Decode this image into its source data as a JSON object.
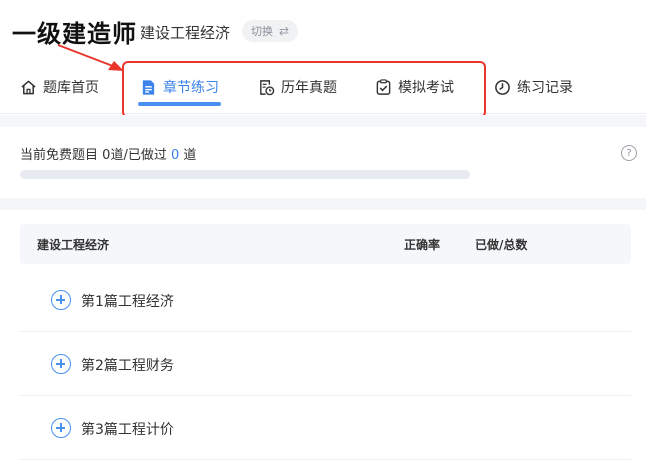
{
  "header": {
    "brand": "一级建造师",
    "subject": "建设工程经济",
    "switch_label": "切换",
    "switch_glyph": "⇄"
  },
  "nav": [
    {
      "label": "题库首页",
      "icon": "home-icon",
      "active": false
    },
    {
      "label": "章节练习",
      "icon": "document-icon",
      "active": true
    },
    {
      "label": "历年真题",
      "icon": "exam-history-icon",
      "active": false
    },
    {
      "label": "模拟考试",
      "icon": "mock-exam-icon",
      "active": false
    },
    {
      "label": "练习记录",
      "icon": "clock-record-icon",
      "active": false
    }
  ],
  "stats": {
    "prefix": "当前免费题目",
    "free_count": "0",
    "middle": "道/已做过",
    "done_count": "0",
    "suffix": "道",
    "progress_percent": 0,
    "help_glyph": "?"
  },
  "table": {
    "col_name": "建设工程经济",
    "col_accuracy": "正确率",
    "col_done_total": "已做/总数",
    "rows": [
      {
        "title": "第1篇工程经济"
      },
      {
        "title": "第2篇工程财务"
      },
      {
        "title": "第3篇工程计价"
      }
    ]
  },
  "colors": {
    "accent": "#3c83ea",
    "highlight": "#e8362b"
  }
}
